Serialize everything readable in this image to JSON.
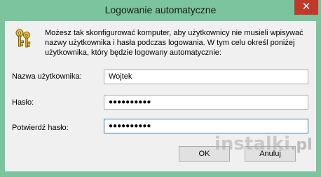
{
  "window": {
    "title": "Logowanie automatyczne",
    "close_glyph": "✕"
  },
  "description": "Możesz tak skonfigurować komputer, aby użytkownicy nie musieli wpisywać nazwy użytkownika i hasła podczas logowania. W tym celu określ poniżej użytkownika, który będzie logowany automatycznie:",
  "form": {
    "username_label": "Nazwa użytkownika:",
    "username_value": "Wojtek",
    "password_label": "Hasło:",
    "password_value": "●●●●●●●●●●",
    "confirm_label": "Potwierdź hasło:",
    "confirm_value": "●●●●●●●●●●"
  },
  "buttons": {
    "ok_label": "OK",
    "cancel_label": "Anuluj"
  },
  "watermark": {
    "text": "instalki",
    "suffix": ".pl"
  },
  "colors": {
    "titlebar": "#7bc49d",
    "close_button": "#c0392b",
    "focus_border": "#3c7fb1"
  },
  "icons": {
    "header_icon": "keys-icon"
  }
}
